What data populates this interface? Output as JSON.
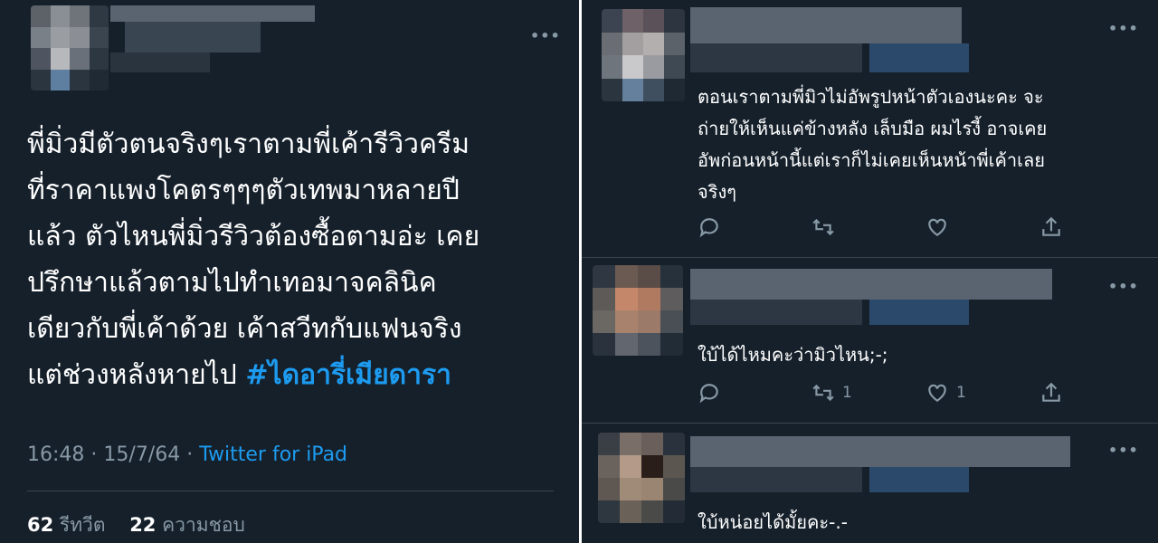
{
  "colors": {
    "background": "#15202b",
    "text": "#ffffff",
    "muted": "#8899a6",
    "accent": "#1d9bf0",
    "divider": "#38444d"
  },
  "main_tweet": {
    "text_lines": [
      "พี่มิ่วมีตัวตนจริงๆเราตามพี่เค้ารีวิวครีม",
      "ที่ราคาแพงโคตรๆๆๆตัวเทพมาหลายปี",
      "แล้ว ตัวไหนพี่มิ่วรีวิวต้องซื้อตามอ่ะ เคย",
      "ปรึกษาแล้วตามไปทำเทอมาจคลินิค",
      "เดียวกับพี่เค้าด้วย เค้าสวีทกับแฟนจริง",
      "แต่ช่วงหลังหายไป "
    ],
    "hashtag": "#ไดอารี่เมียดารา",
    "time": "16:48",
    "separator": "·",
    "date": "15/7/64",
    "source": "Twitter for iPad",
    "retweet_count": "62",
    "retweet_label": "รีทวีต",
    "like_count": "22",
    "like_label": "ความชอบ",
    "more_icon": "more-dots-icon"
  },
  "replies": [
    {
      "text_lines": [
        "ตอนเราตามพี่มิวไม่อัพรูปหน้าตัวเองนะคะ จะ",
        "ถ่ายให้เห็นแค่ข้างหลัง เล็บมือ ผมไรงี้ อาจเคย",
        "อัพก่อนหน้านี้แต่เราก็ไม่เคยเห็นหน้าพี่เค้าเลย",
        "จริงๆ"
      ],
      "retweets": "",
      "likes": ""
    },
    {
      "text_lines": [
        "ใบ้ได้ไหมคะว่ามิวไหน;-;"
      ],
      "retweets": "1",
      "likes": "1"
    },
    {
      "text_lines": [
        "ใบ้หน่อยได้มั้ยคะ-.-"
      ],
      "retweets": "",
      "likes": ""
    }
  ],
  "more_dots": "•••"
}
